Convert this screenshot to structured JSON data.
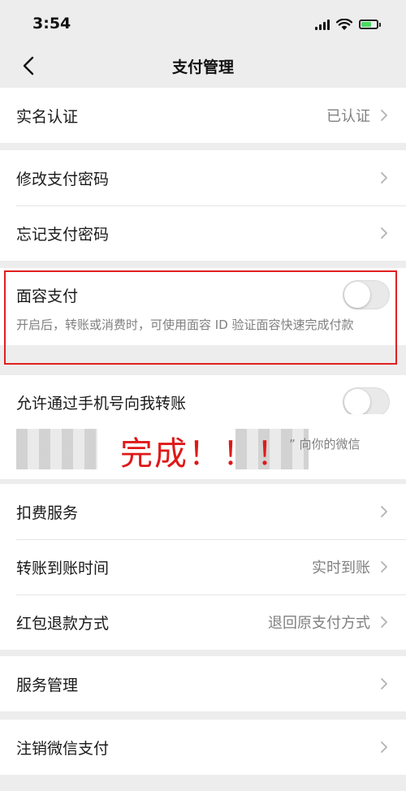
{
  "status_bar": {
    "time": "3:54"
  },
  "nav": {
    "title": "支付管理"
  },
  "real_name": {
    "label": "实名认证",
    "value": "已认证"
  },
  "password_group": [
    {
      "label": "修改支付密码"
    },
    {
      "label": "忘记支付密码"
    }
  ],
  "face_pay": {
    "label": "面容支付",
    "enabled": false,
    "description": "开启后，转账或消费时，可使用面容 ID 验证面容快速完成付款"
  },
  "phone_transfer": {
    "label": "允许通过手机号向我转账",
    "enabled": false,
    "description_partial": "” 向你的微信"
  },
  "overlay_text": "完成！！！",
  "service_group": [
    {
      "label": "扣费服务",
      "value": ""
    },
    {
      "label": "转账到账时间",
      "value": "实时到账"
    },
    {
      "label": "红包退款方式",
      "value": "退回原支付方式"
    }
  ],
  "manage": {
    "label": "服务管理"
  },
  "cancel": {
    "label": "注销微信支付"
  },
  "colors": {
    "highlight": "#e02020",
    "overlay_text": "#e01818",
    "background": "#ededed"
  }
}
